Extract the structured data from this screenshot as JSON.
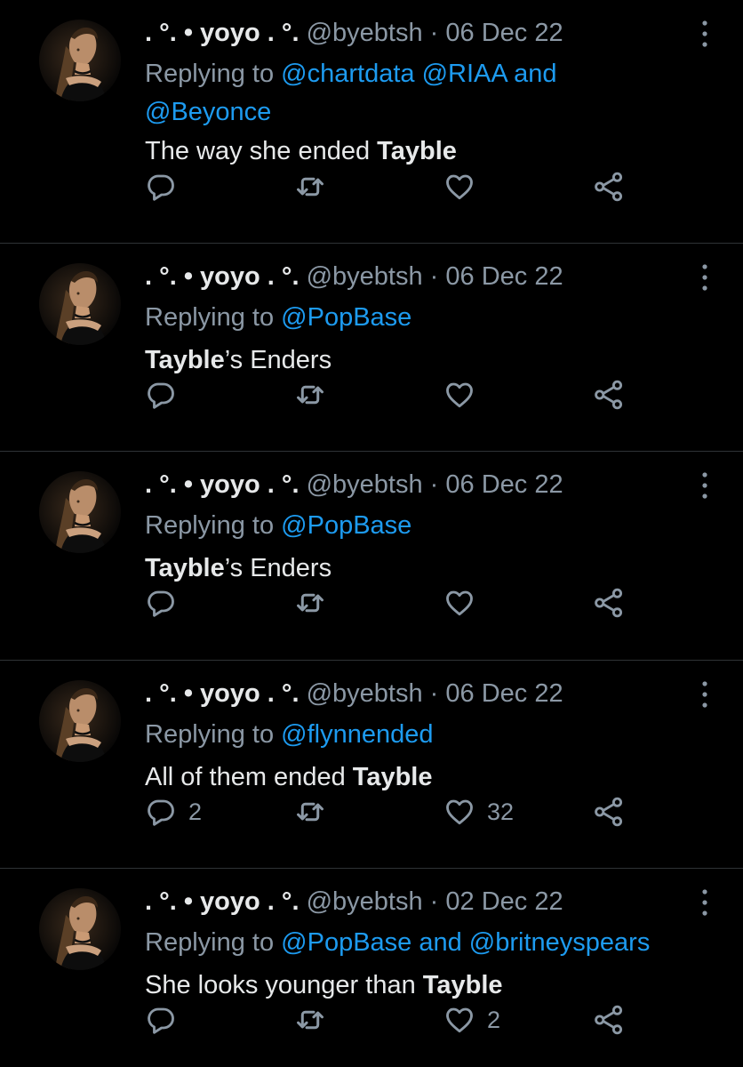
{
  "tweets": [
    {
      "name": ". °. • yoyo . °.",
      "handle": "@byebtsh",
      "date": "06 Dec 22",
      "replying_prefix": "Replying to",
      "reply_line1": [
        {
          "text": "@chartdata",
          "mention": true
        },
        {
          "text": " ",
          "mention": false
        },
        {
          "text": "@RIAA",
          "mention": true
        },
        {
          "text": " and",
          "mention": true
        }
      ],
      "reply_line2": [
        {
          "text": "@Beyonce",
          "mention": true
        }
      ],
      "body": [
        {
          "text": "The way she ended ",
          "bold": false
        },
        {
          "text": "Tayble",
          "bold": true
        }
      ],
      "reply_count": "",
      "retweet_count": "",
      "like_count": ""
    },
    {
      "name": ". °. • yoyo . °.",
      "handle": "@byebtsh",
      "date": "06 Dec 22",
      "replying_prefix": "Replying to",
      "reply_line1": [
        {
          "text": "@PopBase",
          "mention": true
        }
      ],
      "reply_line2": [],
      "body": [
        {
          "text": "Tayble",
          "bold": true
        },
        {
          "text": "’s Enders",
          "bold": false
        }
      ],
      "reply_count": "",
      "retweet_count": "",
      "like_count": ""
    },
    {
      "name": ". °. • yoyo . °.",
      "handle": "@byebtsh",
      "date": "06 Dec 22",
      "replying_prefix": "Replying to",
      "reply_line1": [
        {
          "text": "@PopBase",
          "mention": true
        }
      ],
      "reply_line2": [],
      "body": [
        {
          "text": "Tayble",
          "bold": true
        },
        {
          "text": "’s Enders",
          "bold": false
        }
      ],
      "reply_count": "",
      "retweet_count": "",
      "like_count": ""
    },
    {
      "name": ". °. • yoyo . °.",
      "handle": "@byebtsh",
      "date": "06 Dec 22",
      "replying_prefix": "Replying to",
      "reply_line1": [
        {
          "text": "@flynnended",
          "mention": true
        }
      ],
      "reply_line2": [],
      "body": [
        {
          "text": "All of them ended ",
          "bold": false
        },
        {
          "text": "Tayble",
          "bold": true
        }
      ],
      "reply_count": "2",
      "retweet_count": "",
      "like_count": "32"
    },
    {
      "name": ". °. • yoyo . °.",
      "handle": "@byebtsh",
      "date": "02 Dec 22",
      "replying_prefix": "Replying to",
      "reply_line1": [
        {
          "text": "@PopBase",
          "mention": true
        },
        {
          "text": " and ",
          "mention": true
        },
        {
          "text": "@britneyspears",
          "mention": true
        }
      ],
      "reply_line2": [],
      "body": [
        {
          "text": "She looks younger than ",
          "bold": false
        },
        {
          "text": "Tayble",
          "bold": true
        }
      ],
      "reply_count": "",
      "retweet_count": "",
      "like_count": "2"
    }
  ],
  "icons": {
    "reply": "reply-icon",
    "retweet": "retweet-icon",
    "like": "heart-icon",
    "share": "share-icon",
    "more": "more-icon"
  },
  "colors": {
    "background": "#000000",
    "text": "#e7e9ea",
    "muted": "#8b98a5",
    "mention": "#1d9bf0",
    "divider": "#2f3336"
  }
}
